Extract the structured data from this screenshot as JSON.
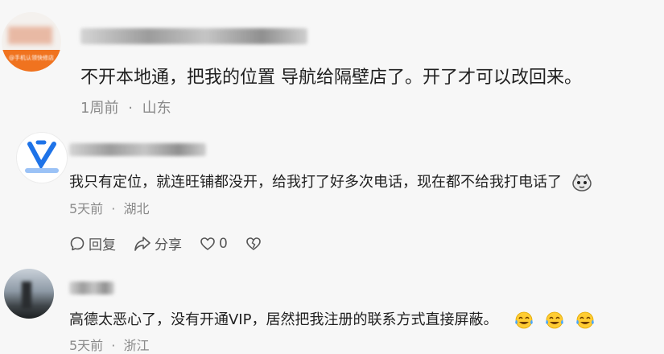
{
  "comments": [
    {
      "text": "不开本地通，把我的位置 导航给隔壁店了。开了才可以改回来。",
      "time": "1周前",
      "location": "山东",
      "avatar_text": "@手机认领快修店"
    },
    {
      "text": "我只有定位，就连旺铺都没开，给我打了好多次电话，现在都不给我打电话了",
      "time": "5天前",
      "location": "湖北",
      "actions": {
        "reply": "回复",
        "share": "分享",
        "like_count": "0"
      }
    },
    {
      "text": "高德太恶心了，没有开通VIP，居然把我注册的联系方式直接屏蔽。",
      "time": "5天前",
      "location": "浙江"
    }
  ],
  "separator": "·",
  "icons": [
    "sticker-icon",
    "reply-icon",
    "share-icon",
    "like-icon",
    "dislike-icon",
    "laughing-tears-emoji"
  ]
}
